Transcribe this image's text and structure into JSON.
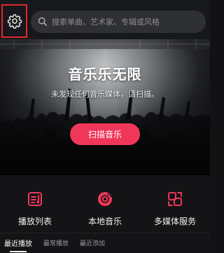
{
  "header": {
    "settings_icon": "gear-icon",
    "search": {
      "icon": "search-icon",
      "placeholder": "搜索单曲、艺术家、专辑或风格"
    }
  },
  "hero": {
    "title": "音乐乐无限",
    "subtitle": "未发现任何音乐媒体，请扫描。",
    "scan_button": "扫描音乐"
  },
  "features": [
    {
      "label": "播放列表",
      "icon": "playlist-icon"
    },
    {
      "label": "本地音乐",
      "icon": "disc-icon"
    },
    {
      "label": "多媒体服务",
      "icon": "media-service-icon"
    }
  ],
  "tabs": [
    {
      "label": "最近播放",
      "active": true
    },
    {
      "label": "最常播放",
      "active": false
    },
    {
      "label": "最近添加",
      "active": false
    }
  ],
  "colors": {
    "accent": "#f0375a",
    "highlight_border": "#e0262f",
    "background": "#141416"
  }
}
